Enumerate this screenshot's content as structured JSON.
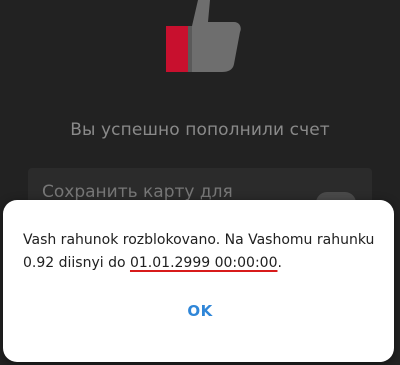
{
  "background": {
    "success_message": "Вы успешно пополнили счет",
    "save_card_label": "Сохранить карту для",
    "thumb_icon": "thumbs-up-icon",
    "accent_color": "#d0021b"
  },
  "dialog": {
    "message_prefix": "Vash rahunok rozblokovano. Na Vashomu rahunku 0.92  diisnyi do ",
    "message_highlight": "01.01.2999 00:00:00",
    "message_suffix": ".",
    "ok_label": "OK",
    "button_color": "#2f86d8",
    "underline_color": "#d81b1b"
  }
}
